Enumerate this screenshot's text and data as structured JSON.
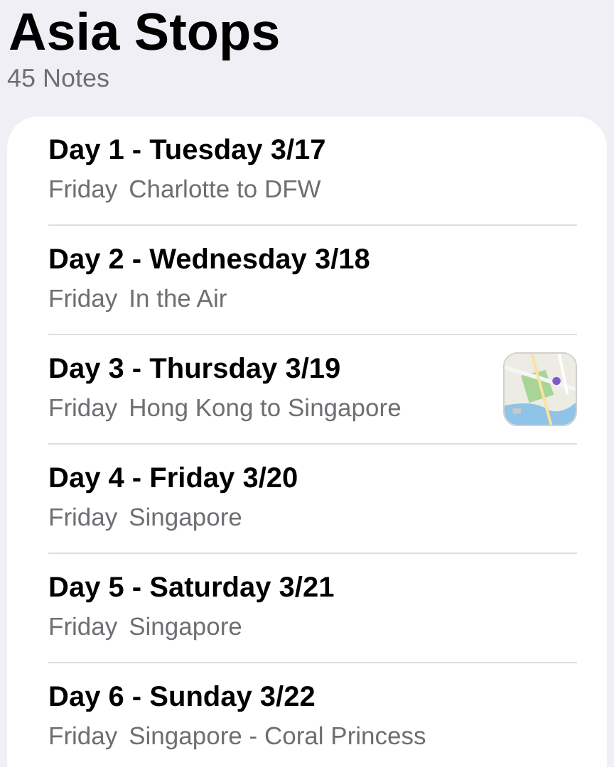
{
  "folder": {
    "title": "Asia Stops",
    "count": "45 Notes"
  },
  "notes": [
    {
      "title": "Day 1 - Tuesday 3/17",
      "date": "Friday",
      "preview": "Charlotte to DFW"
    },
    {
      "title": "Day 2 - Wednesday 3/18",
      "date": "Friday",
      "preview": "In the Air"
    },
    {
      "title": "Day 3 - Thursday 3/19",
      "date": "Friday",
      "preview": "Hong Kong to Singapore"
    },
    {
      "title": "Day 4 - Friday 3/20",
      "date": "Friday",
      "preview": "Singapore"
    },
    {
      "title": "Day 5 - Saturday 3/21",
      "date": "Friday",
      "preview": "Singapore"
    },
    {
      "title": "Day 6 - Sunday 3/22",
      "date": "Friday",
      "preview": "Singapore - Coral Princess"
    }
  ]
}
